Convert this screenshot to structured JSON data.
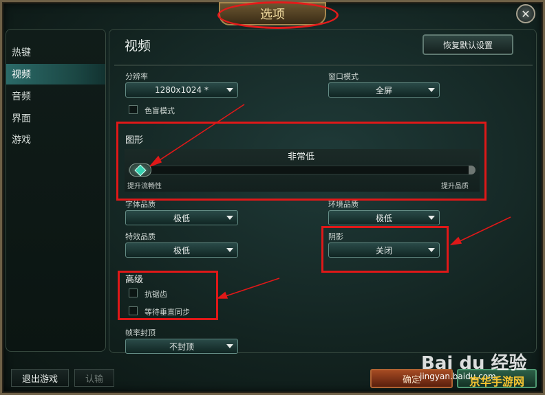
{
  "window": {
    "title": "选项",
    "close_icon": "close-icon"
  },
  "sidebar": {
    "items": [
      {
        "label": "热键"
      },
      {
        "label": "视频"
      },
      {
        "label": "音频"
      },
      {
        "label": "界面"
      },
      {
        "label": "游戏"
      }
    ],
    "active": "视频"
  },
  "main": {
    "title": "视频",
    "reset_label": "恢复默认设置",
    "resolution": {
      "label": "分辨率",
      "value": "1280x1024 *"
    },
    "window_mode": {
      "label": "窗口模式",
      "value": "全屏"
    },
    "colorblind": {
      "label": "色盲模式",
      "checked": false
    },
    "graphics": {
      "title": "图形",
      "level": "非常低",
      "level_index": 0,
      "left_label": "提升流畅性",
      "right_label": "提升品质"
    },
    "character_quality": {
      "label": "字体品质",
      "value": "极低"
    },
    "environment_quality": {
      "label": "环境品质",
      "value": "极低"
    },
    "effects_quality": {
      "label": "特效品质",
      "value": "极低"
    },
    "shadows": {
      "label": "阴影",
      "value": "关闭"
    },
    "advanced": {
      "title": "高级",
      "antialias": {
        "label": "抗锯齿",
        "checked": false
      },
      "vsync": {
        "label": "等待垂直同步",
        "checked": false
      }
    },
    "frame_cap": {
      "label": "帧率封顶",
      "value": "不封顶"
    }
  },
  "footer": {
    "exit_label": "退出游戏",
    "surrender_label": "认输",
    "confirm_label": "确定"
  },
  "watermark": {
    "brand": "Bai du 经验",
    "url": "jingyan.baidu.com",
    "site": "京华手游网"
  },
  "colors": {
    "annotation_red": "#e01818",
    "active_tab": "#2b6a68",
    "gold": "#a8894f"
  }
}
